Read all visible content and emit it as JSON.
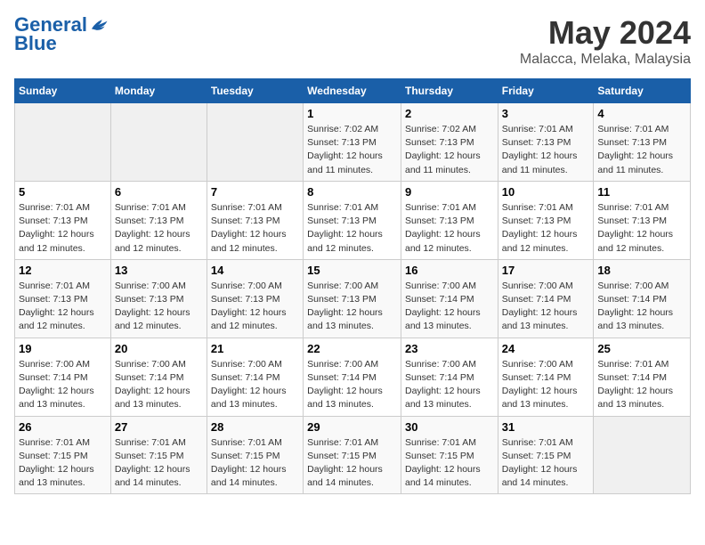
{
  "logo": {
    "line1": "General",
    "line2": "Blue"
  },
  "title": {
    "month": "May 2024",
    "location": "Malacca, Melaka, Malaysia"
  },
  "header_days": [
    "Sunday",
    "Monday",
    "Tuesday",
    "Wednesday",
    "Thursday",
    "Friday",
    "Saturday"
  ],
  "weeks": [
    [
      {
        "date": "",
        "info": ""
      },
      {
        "date": "",
        "info": ""
      },
      {
        "date": "",
        "info": ""
      },
      {
        "date": "1",
        "info": "Sunrise: 7:02 AM\nSunset: 7:13 PM\nDaylight: 12 hours and 11 minutes."
      },
      {
        "date": "2",
        "info": "Sunrise: 7:02 AM\nSunset: 7:13 PM\nDaylight: 12 hours and 11 minutes."
      },
      {
        "date": "3",
        "info": "Sunrise: 7:01 AM\nSunset: 7:13 PM\nDaylight: 12 hours and 11 minutes."
      },
      {
        "date": "4",
        "info": "Sunrise: 7:01 AM\nSunset: 7:13 PM\nDaylight: 12 hours and 11 minutes."
      }
    ],
    [
      {
        "date": "5",
        "info": "Sunrise: 7:01 AM\nSunset: 7:13 PM\nDaylight: 12 hours and 12 minutes."
      },
      {
        "date": "6",
        "info": "Sunrise: 7:01 AM\nSunset: 7:13 PM\nDaylight: 12 hours and 12 minutes."
      },
      {
        "date": "7",
        "info": "Sunrise: 7:01 AM\nSunset: 7:13 PM\nDaylight: 12 hours and 12 minutes."
      },
      {
        "date": "8",
        "info": "Sunrise: 7:01 AM\nSunset: 7:13 PM\nDaylight: 12 hours and 12 minutes."
      },
      {
        "date": "9",
        "info": "Sunrise: 7:01 AM\nSunset: 7:13 PM\nDaylight: 12 hours and 12 minutes."
      },
      {
        "date": "10",
        "info": "Sunrise: 7:01 AM\nSunset: 7:13 PM\nDaylight: 12 hours and 12 minutes."
      },
      {
        "date": "11",
        "info": "Sunrise: 7:01 AM\nSunset: 7:13 PM\nDaylight: 12 hours and 12 minutes."
      }
    ],
    [
      {
        "date": "12",
        "info": "Sunrise: 7:01 AM\nSunset: 7:13 PM\nDaylight: 12 hours and 12 minutes."
      },
      {
        "date": "13",
        "info": "Sunrise: 7:00 AM\nSunset: 7:13 PM\nDaylight: 12 hours and 12 minutes."
      },
      {
        "date": "14",
        "info": "Sunrise: 7:00 AM\nSunset: 7:13 PM\nDaylight: 12 hours and 12 minutes."
      },
      {
        "date": "15",
        "info": "Sunrise: 7:00 AM\nSunset: 7:13 PM\nDaylight: 12 hours and 13 minutes."
      },
      {
        "date": "16",
        "info": "Sunrise: 7:00 AM\nSunset: 7:14 PM\nDaylight: 12 hours and 13 minutes."
      },
      {
        "date": "17",
        "info": "Sunrise: 7:00 AM\nSunset: 7:14 PM\nDaylight: 12 hours and 13 minutes."
      },
      {
        "date": "18",
        "info": "Sunrise: 7:00 AM\nSunset: 7:14 PM\nDaylight: 12 hours and 13 minutes."
      }
    ],
    [
      {
        "date": "19",
        "info": "Sunrise: 7:00 AM\nSunset: 7:14 PM\nDaylight: 12 hours and 13 minutes."
      },
      {
        "date": "20",
        "info": "Sunrise: 7:00 AM\nSunset: 7:14 PM\nDaylight: 12 hours and 13 minutes."
      },
      {
        "date": "21",
        "info": "Sunrise: 7:00 AM\nSunset: 7:14 PM\nDaylight: 12 hours and 13 minutes."
      },
      {
        "date": "22",
        "info": "Sunrise: 7:00 AM\nSunset: 7:14 PM\nDaylight: 12 hours and 13 minutes."
      },
      {
        "date": "23",
        "info": "Sunrise: 7:00 AM\nSunset: 7:14 PM\nDaylight: 12 hours and 13 minutes."
      },
      {
        "date": "24",
        "info": "Sunrise: 7:00 AM\nSunset: 7:14 PM\nDaylight: 12 hours and 13 minutes."
      },
      {
        "date": "25",
        "info": "Sunrise: 7:01 AM\nSunset: 7:14 PM\nDaylight: 12 hours and 13 minutes."
      }
    ],
    [
      {
        "date": "26",
        "info": "Sunrise: 7:01 AM\nSunset: 7:15 PM\nDaylight: 12 hours and 13 minutes."
      },
      {
        "date": "27",
        "info": "Sunrise: 7:01 AM\nSunset: 7:15 PM\nDaylight: 12 hours and 14 minutes."
      },
      {
        "date": "28",
        "info": "Sunrise: 7:01 AM\nSunset: 7:15 PM\nDaylight: 12 hours and 14 minutes."
      },
      {
        "date": "29",
        "info": "Sunrise: 7:01 AM\nSunset: 7:15 PM\nDaylight: 12 hours and 14 minutes."
      },
      {
        "date": "30",
        "info": "Sunrise: 7:01 AM\nSunset: 7:15 PM\nDaylight: 12 hours and 14 minutes."
      },
      {
        "date": "31",
        "info": "Sunrise: 7:01 AM\nSunset: 7:15 PM\nDaylight: 12 hours and 14 minutes."
      },
      {
        "date": "",
        "info": ""
      }
    ]
  ]
}
